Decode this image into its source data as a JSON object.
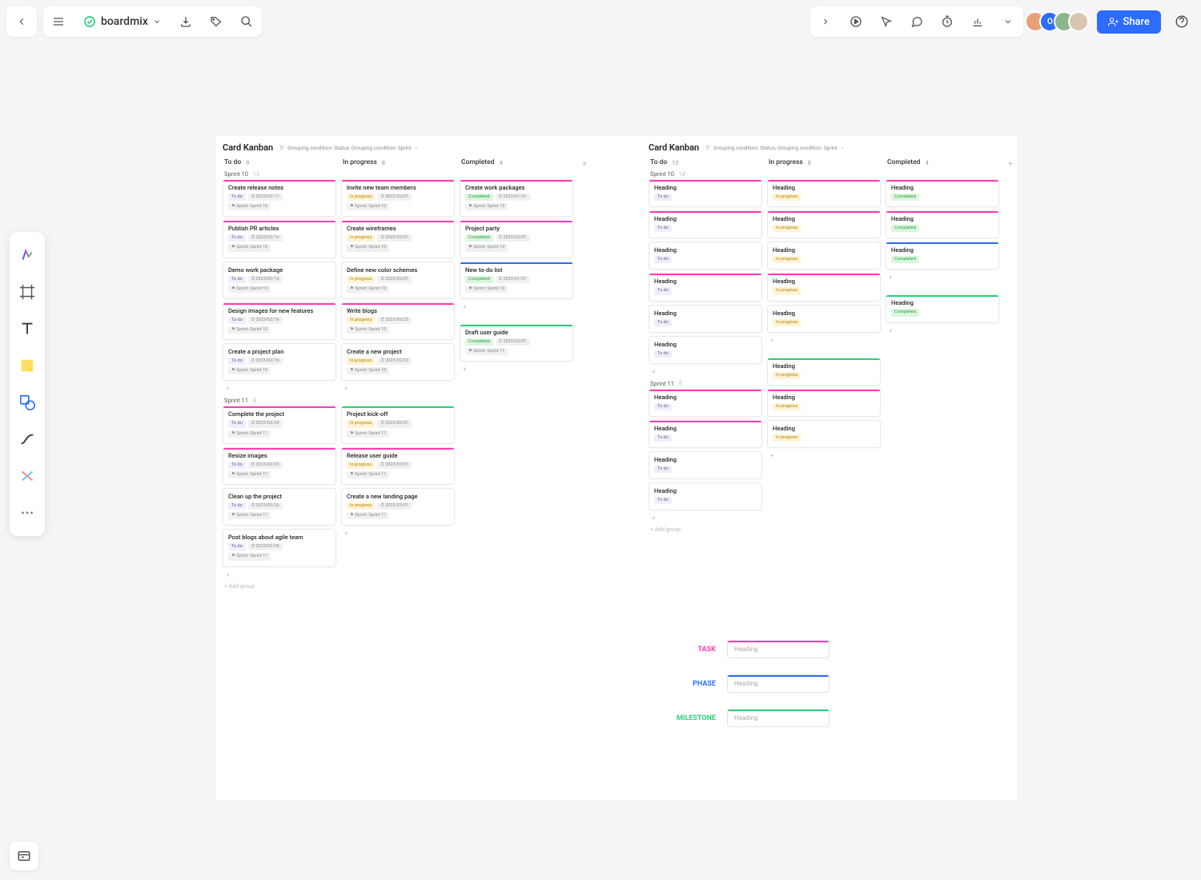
{
  "app": {
    "name": "boardmix",
    "share_label": "Share"
  },
  "avatars": [
    "",
    "O",
    "",
    ""
  ],
  "board1": {
    "title": "Card Kanban",
    "condition": "Grouping condition: Status; Grouping condition: Sprint",
    "columns": [
      {
        "name": "To do",
        "count": "9"
      },
      {
        "name": "In progress",
        "count": "8"
      },
      {
        "name": "Completed",
        "count": "4"
      }
    ],
    "groups": [
      {
        "name": "Sprint 10",
        "count": "13",
        "cols": [
          [
            {
              "t": "Create release notes",
              "bar": "pink",
              "b": [
                "todo",
                "2023/02/17"
              ],
              "s": "Sprint: Sprint 10"
            },
            {
              "t": "Publish PR articles",
              "bar": "pink",
              "b": [
                "todo",
                "2023/02/16"
              ],
              "s": "Sprint: Sprint 10"
            },
            {
              "t": "Demo work package",
              "bar": "",
              "b": [
                "todo",
                "2023/02/16"
              ],
              "s": "Sprint: Sprint 10"
            },
            {
              "t": "Design images for new features",
              "bar": "pink",
              "b": [
                "todo",
                "2023/02/16"
              ],
              "s": "Sprint: Sprint 10"
            },
            {
              "t": "Create a project plan",
              "bar": "",
              "b": [
                "todo",
                "2023/02/16"
              ],
              "s": "Sprint: Sprint 10"
            }
          ],
          [
            {
              "t": "Invite new team members",
              "bar": "pink",
              "b": [
                "prog",
                "2023/02/01"
              ],
              "s": "Sprint: Sprint 10"
            },
            {
              "t": "Create wireframes",
              "bar": "pink",
              "b": [
                "prog",
                "2023/02/01"
              ],
              "s": "Sprint: Sprint 10"
            },
            {
              "t": "Define new color schemes",
              "bar": "",
              "b": [
                "prog",
                "2023/02/01"
              ],
              "s": "Sprint: Sprint 10"
            },
            {
              "t": "Write blogs",
              "bar": "pink",
              "b": [
                "prog",
                "2023/02/23"
              ],
              "s": "Sprint: Sprint 10"
            },
            {
              "t": "Create a new project",
              "bar": "",
              "b": [
                "prog",
                "2023/02/22"
              ],
              "s": "Sprint: Sprint 10"
            }
          ],
          [
            {
              "t": "Create work packages",
              "bar": "pink",
              "b": [
                "comp",
                "2023/01/31"
              ],
              "s": "Sprint: Sprint 10"
            },
            {
              "t": "Project party",
              "bar": "pink",
              "b": [
                "comp",
                "2023/02/01"
              ],
              "s": "Sprint: Sprint 10"
            },
            {
              "t": "New to-do list",
              "bar": "blue",
              "b": [
                "comp",
                "2023/01/31"
              ],
              "s": "Sprint: Sprint 10"
            }
          ]
        ]
      },
      {
        "name": "Sprint 11",
        "count": "8",
        "cols": [
          [
            {
              "t": "Complete the project",
              "bar": "pink",
              "b": [
                "todo",
                "2023/02/24"
              ],
              "s": "Sprint: Sprint 11"
            },
            {
              "t": "Resize images",
              "bar": "pink",
              "b": [
                "todo",
                "2023/02/25"
              ],
              "s": "Sprint: Sprint 11"
            },
            {
              "t": "Clean up the project",
              "bar": "",
              "b": [
                "todo",
                "2023/02/26"
              ],
              "s": "Sprint: Sprint 11"
            },
            {
              "t": "Post blogs about agile team",
              "bar": "",
              "b": [
                "todo",
                "2023/02/28"
              ],
              "s": "Sprint: Sprint 11"
            }
          ],
          [
            {
              "t": "Project kick-off",
              "bar": "green",
              "b": [
                "prog",
                "2023/02/01"
              ],
              "s": "Sprint: Sprint 11"
            },
            {
              "t": "Release user guide",
              "bar": "pink",
              "b": [
                "prog",
                "2023/03/01"
              ],
              "s": "Sprint: Sprint 11"
            },
            {
              "t": "Create a new landing page",
              "bar": "",
              "b": [
                "prog",
                "2023/03/01"
              ],
              "s": "Sprint: Sprint 11"
            }
          ],
          [
            {
              "t": "Draft user guide",
              "bar": "green",
              "b": [
                "comp",
                "2023/02/01"
              ],
              "s": "Sprint: Sprint 11"
            }
          ]
        ]
      }
    ],
    "add_group": "+ Add group"
  },
  "board2": {
    "title": "Card Kanban",
    "condition": "Grouping condition: Status; Grouping condition: Sprint",
    "columns": [
      {
        "name": "To do",
        "count": "10"
      },
      {
        "name": "In progress",
        "count": "8"
      },
      {
        "name": "Completed",
        "count": "4"
      }
    ],
    "groups": [
      {
        "name": "Sprint 10",
        "count": "14",
        "cols": [
          [
            {
              "t": "Heading",
              "bar": "pink",
              "b": [
                "todo"
              ]
            },
            {
              "t": "Heading",
              "bar": "pink",
              "b": [
                "todo"
              ]
            },
            {
              "t": "Heading",
              "bar": "",
              "b": [
                "todo"
              ]
            },
            {
              "t": "Heading",
              "bar": "pink",
              "b": [
                "todo"
              ]
            },
            {
              "t": "Heading",
              "bar": "",
              "b": [
                "todo"
              ]
            },
            {
              "t": "Heading",
              "bar": "",
              "b": [
                "todo"
              ]
            }
          ],
          [
            {
              "t": "Heading",
              "bar": "pink",
              "b": [
                "prog"
              ]
            },
            {
              "t": "Heading",
              "bar": "pink",
              "b": [
                "prog"
              ]
            },
            {
              "t": "Heading",
              "bar": "",
              "b": [
                "prog"
              ]
            },
            {
              "t": "Heading",
              "bar": "pink",
              "b": [
                "prog"
              ]
            },
            {
              "t": "Heading",
              "bar": "",
              "b": [
                "prog"
              ]
            }
          ],
          [
            {
              "t": "Heading",
              "bar": "pink",
              "b": [
                "comp"
              ]
            },
            {
              "t": "Heading",
              "bar": "pink",
              "b": [
                "comp"
              ]
            },
            {
              "t": "Heading",
              "bar": "blue",
              "b": [
                "comp"
              ]
            }
          ]
        ]
      },
      {
        "name": "Sprint 11",
        "count": "8",
        "cols": [
          [
            {
              "t": "Heading",
              "bar": "pink",
              "b": [
                "todo"
              ]
            },
            {
              "t": "Heading",
              "bar": "pink",
              "b": [
                "todo"
              ]
            },
            {
              "t": "Heading",
              "bar": "",
              "b": [
                "todo"
              ]
            },
            {
              "t": "Heading",
              "bar": "",
              "b": [
                "todo"
              ]
            }
          ],
          [
            {
              "t": "Heading",
              "bar": "green",
              "b": [
                "prog"
              ]
            },
            {
              "t": "Heading",
              "bar": "pink",
              "b": [
                "prog"
              ]
            },
            {
              "t": "Heading",
              "bar": "",
              "b": [
                "prog"
              ]
            }
          ],
          [
            {
              "t": "Heading",
              "bar": "green",
              "b": [
                "comp"
              ]
            }
          ]
        ]
      }
    ],
    "add_group": "+ Add group"
  },
  "legend": {
    "task": "TASK",
    "phase": "PHASE",
    "milestone": "MILESTONE",
    "heading": "Heading"
  },
  "status_labels": {
    "todo": "To do",
    "prog": "In progress",
    "comp": "Completed"
  }
}
